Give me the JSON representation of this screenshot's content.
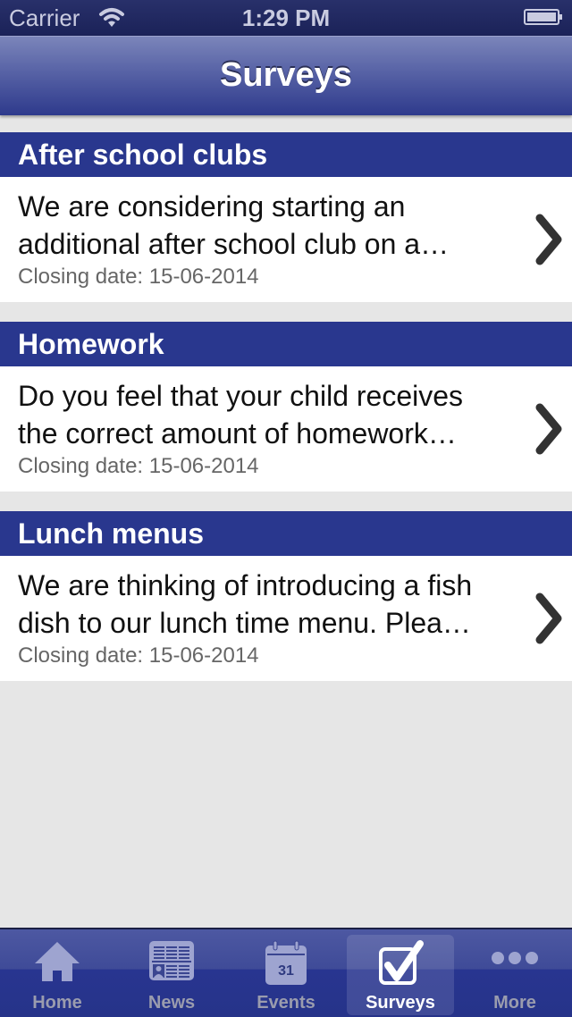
{
  "status_bar": {
    "carrier": "Carrier",
    "time": "1:29 PM",
    "wifi_icon": "wifi-icon",
    "battery_icon": "battery-icon"
  },
  "nav": {
    "title": "Surveys"
  },
  "surveys": [
    {
      "title": "After school clubs",
      "description": "We are considering starting an additional after school club on a…",
      "closing": "Closing date: 15-06-2014"
    },
    {
      "title": "Homework",
      "description": "Do you feel that your child receives the correct amount of homework…",
      "closing": "Closing date: 15-06-2014"
    },
    {
      "title": "Lunch menus",
      "description": "We are thinking of introducing a fish dish to our lunch time menu.  Plea…",
      "closing": "Closing date: 15-06-2014"
    }
  ],
  "tabs": [
    {
      "label": "Home",
      "icon": "home-icon",
      "active": false
    },
    {
      "label": "News",
      "icon": "newspaper-icon",
      "active": false
    },
    {
      "label": "Events",
      "icon": "calendar-icon",
      "active": false,
      "calendar_day": "31"
    },
    {
      "label": "Surveys",
      "icon": "checkbox-icon",
      "active": true
    },
    {
      "label": "More",
      "icon": "more-icon",
      "active": false
    }
  ],
  "colors": {
    "section_header": "#29378e",
    "nav_bar": "#4a559e",
    "tab_bar": "#283590",
    "background": "#e6e6e6"
  }
}
